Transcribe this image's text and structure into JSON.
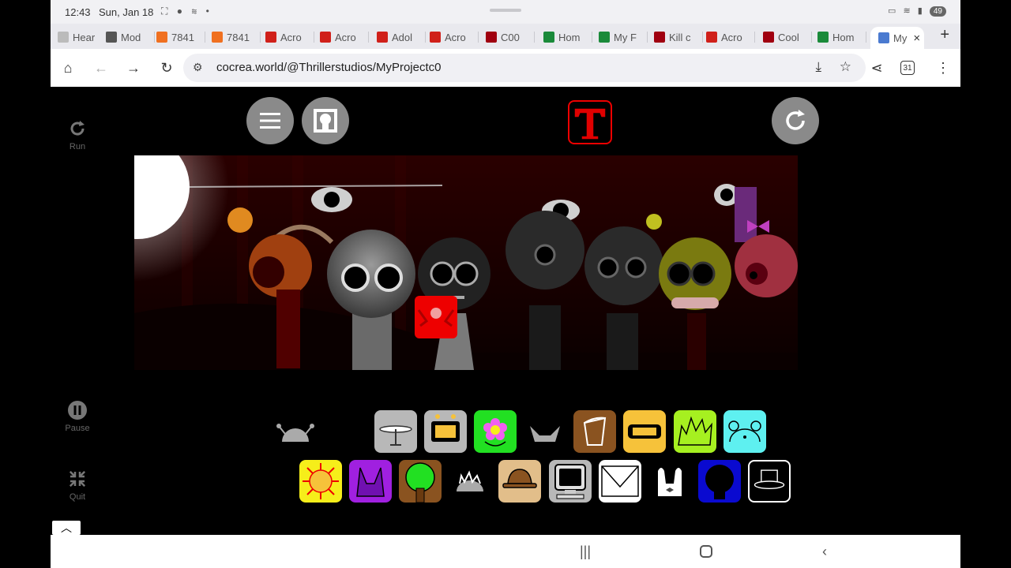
{
  "status": {
    "time": "12:43",
    "date": "Sun, Jan 18",
    "battery": "49"
  },
  "tabs": [
    {
      "label": "Hear",
      "color": "#bbbbbb"
    },
    {
      "label": "Mod",
      "color": "#555555"
    },
    {
      "label": "7841",
      "color": "#f07020"
    },
    {
      "label": "7841",
      "color": "#f07020"
    },
    {
      "label": "Acro",
      "color": "#d0201a"
    },
    {
      "label": "Acro",
      "color": "#d0201a"
    },
    {
      "label": "Adol",
      "color": "#d0201a"
    },
    {
      "label": "Acro",
      "color": "#d0201a"
    },
    {
      "label": "C00",
      "color": "#a00010"
    },
    {
      "label": "Hom",
      "color": "#1a8a3a"
    },
    {
      "label": "My F",
      "color": "#1a8a3a"
    },
    {
      "label": "Kill c",
      "color": "#a00010"
    },
    {
      "label": "Acro",
      "color": "#d0201a"
    },
    {
      "label": "Cool",
      "color": "#a00010"
    },
    {
      "label": "Hom",
      "color": "#1a8a3a"
    },
    {
      "label": "My",
      "color": "#4a7ad0"
    }
  ],
  "address": {
    "url": "cocrea.world/@Thrillerstudios/MyProjectc0"
  },
  "side": {
    "run": "Run",
    "pause": "Pause",
    "quit": "Quit"
  },
  "palette_row1": [
    {
      "name": "antenna-dome-icon",
      "bg": "#000000"
    },
    {
      "name": "cymbal-icon",
      "bg": "#b8b8b8"
    },
    {
      "name": "monitor-head-icon",
      "bg": "#b8b8b8"
    },
    {
      "name": "flower-icon",
      "bg": "#22e022"
    },
    {
      "name": "horns-icon",
      "bg": "#000000"
    },
    {
      "name": "bucket-icon",
      "bg": "#8a5320"
    },
    {
      "name": "visor-icon",
      "bg": "#f6c23a"
    },
    {
      "name": "spiky-hair-icon",
      "bg": "#a6f020"
    },
    {
      "name": "bear-ears-icon",
      "bg": "#5ef0f0"
    }
  ],
  "palette_row2": [
    {
      "name": "sun-icon",
      "bg": "#f6ee1a"
    },
    {
      "name": "purple-horns-icon",
      "bg": "#a020e0"
    },
    {
      "name": "tree-icon",
      "bg": "#8a5320"
    },
    {
      "name": "spiky-dome-icon",
      "bg": "#000000"
    },
    {
      "name": "brown-hat-icon",
      "bg": "#e2be8a"
    },
    {
      "name": "computer-icon",
      "bg": "#b8b8b8"
    },
    {
      "name": "envelope-icon",
      "bg": "#ffffff"
    },
    {
      "name": "bunny-ears-icon",
      "bg": "#000000"
    },
    {
      "name": "dark-head-icon",
      "bg": "#0a0ad0"
    },
    {
      "name": "top-hat-icon",
      "bg": "#000000"
    }
  ],
  "colors": {
    "logo_red": "#e00000",
    "button_grey": "#8a8a8a"
  }
}
